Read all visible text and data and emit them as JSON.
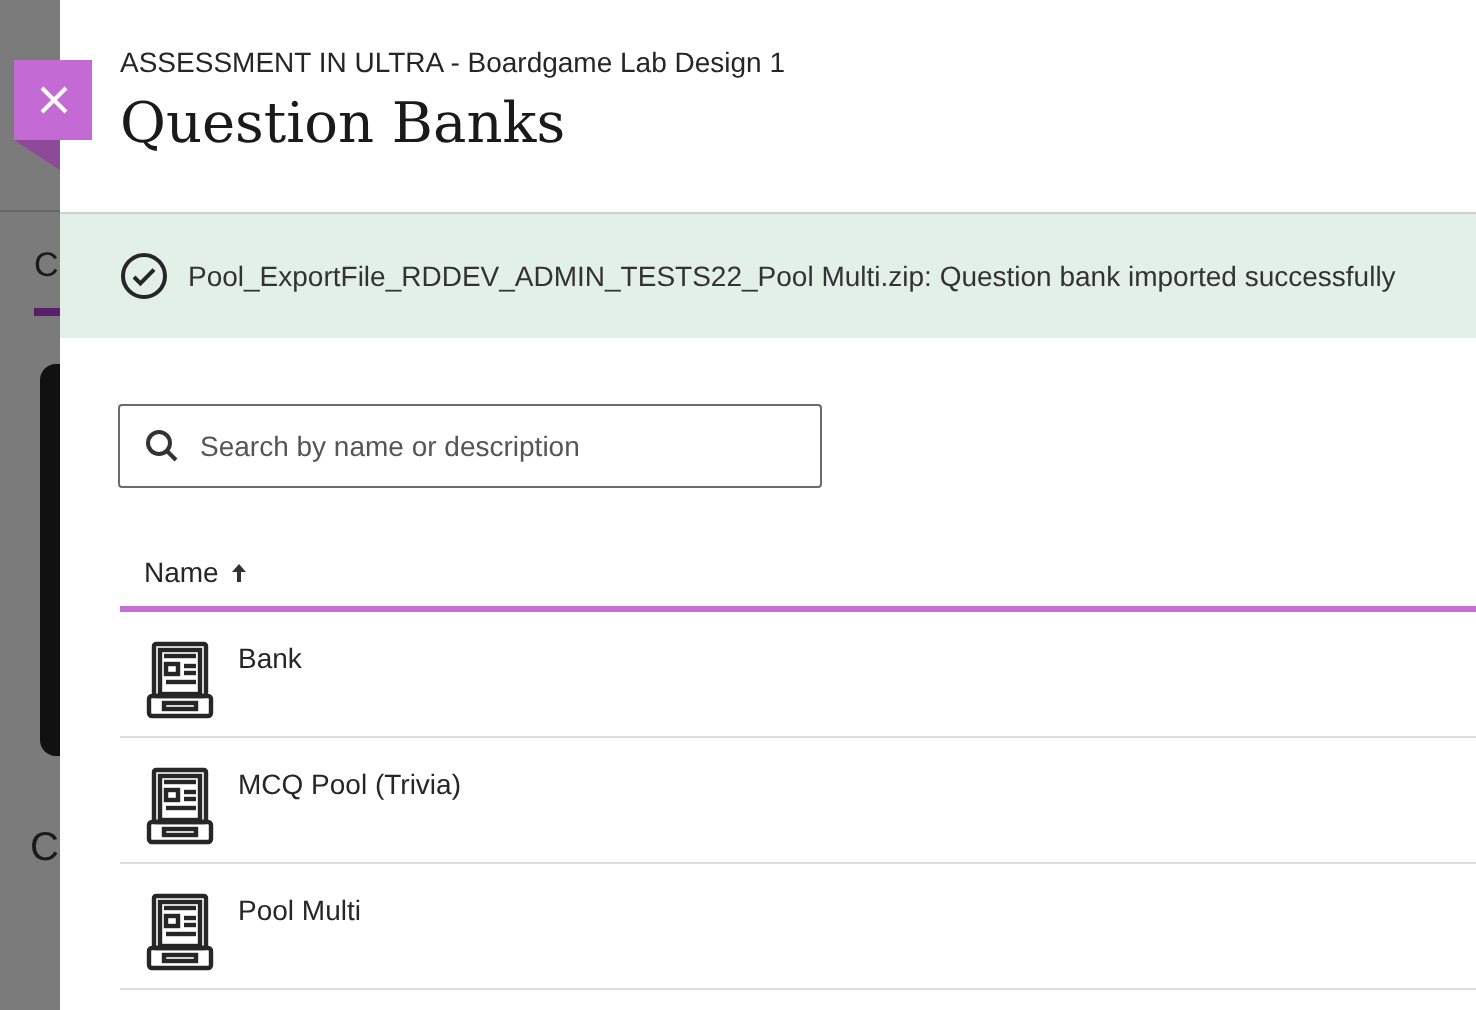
{
  "background_page": {
    "tab": {
      "label": "C",
      "selected": true
    },
    "heading": "C"
  },
  "panel": {
    "breadcrumb": "ASSESSMENT IN ULTRA - Boardgame Lab Design 1",
    "title": "Question Banks",
    "banner": {
      "message": "Pool_ExportFile_RDDEV_ADMIN_TESTS22_Pool Multi.zip: Question bank imported successfully"
    },
    "search": {
      "placeholder": "Search by name or description"
    },
    "table": {
      "columns": [
        {
          "label": "Name",
          "sorted_ascending": true
        }
      ],
      "rows": [
        {
          "name": "Bank"
        },
        {
          "name": "MCQ Pool (Trivia)"
        },
        {
          "name": "Pool Multi"
        }
      ]
    }
  }
}
